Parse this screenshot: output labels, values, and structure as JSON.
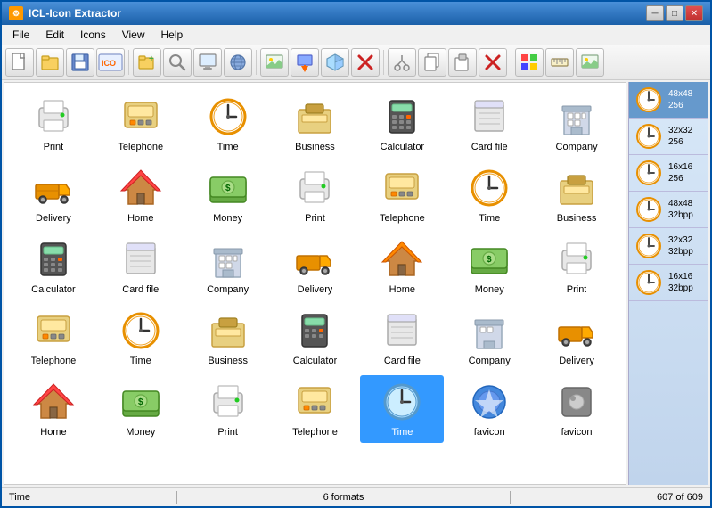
{
  "window": {
    "title": "ICL-Icon Extractor",
    "title_icon": "📦"
  },
  "title_controls": {
    "minimize": "─",
    "maximize": "□",
    "close": "✕"
  },
  "menu": {
    "items": [
      "File",
      "Edit",
      "Icons",
      "View",
      "Help"
    ]
  },
  "toolbar": {
    "buttons": [
      {
        "name": "new",
        "icon": "📄"
      },
      {
        "name": "open",
        "icon": "📂"
      },
      {
        "name": "save",
        "icon": "💾"
      },
      {
        "name": "ico",
        "icon": "🏷"
      },
      {
        "name": "add-folder",
        "icon": "📁"
      },
      {
        "name": "search",
        "icon": "🔍"
      },
      {
        "name": "monitor",
        "icon": "🖥"
      },
      {
        "name": "globe",
        "icon": "🌐"
      },
      {
        "name": "image",
        "icon": "🖼"
      },
      {
        "name": "download",
        "icon": "⬇"
      },
      {
        "name": "cube",
        "icon": "📦"
      },
      {
        "name": "delete-red",
        "icon": "✖"
      },
      {
        "name": "cut",
        "icon": "✂"
      },
      {
        "name": "copy",
        "icon": "📋"
      },
      {
        "name": "paste",
        "icon": "📋"
      },
      {
        "name": "delete",
        "icon": "🗑"
      },
      {
        "name": "windows",
        "icon": "🪟"
      },
      {
        "name": "ruler",
        "icon": "📏"
      },
      {
        "name": "image2",
        "icon": "🖼"
      }
    ]
  },
  "icons": [
    {
      "label": "Print",
      "emoji": "🖨",
      "type": "printer"
    },
    {
      "label": "Telephone",
      "emoji": "☎",
      "type": "telephone"
    },
    {
      "label": "Time",
      "emoji": "🕐",
      "type": "clock"
    },
    {
      "label": "Business",
      "emoji": "💼",
      "type": "business"
    },
    {
      "label": "Calculator",
      "emoji": "🧮",
      "type": "calculator"
    },
    {
      "label": "Card file",
      "emoji": "🗃",
      "type": "cardfile"
    },
    {
      "label": "Company",
      "emoji": "🏢",
      "type": "building"
    },
    {
      "label": "Delivery",
      "emoji": "🚚",
      "type": "truck"
    },
    {
      "label": "Home",
      "emoji": "🏠",
      "type": "house"
    },
    {
      "label": "Money",
      "emoji": "💵",
      "type": "money"
    },
    {
      "label": "Print",
      "emoji": "🖨",
      "type": "printer"
    },
    {
      "label": "Telephone",
      "emoji": "☎",
      "type": "telephone"
    },
    {
      "label": "Time",
      "emoji": "🕐",
      "type": "clock"
    },
    {
      "label": "Business",
      "emoji": "💼",
      "type": "business"
    },
    {
      "label": "Calculator",
      "emoji": "🧮",
      "type": "calculator"
    },
    {
      "label": "Card file",
      "emoji": "🗃",
      "type": "cardfile"
    },
    {
      "label": "Company",
      "emoji": "🏢",
      "type": "building"
    },
    {
      "label": "Delivery",
      "emoji": "🚚",
      "type": "truck"
    },
    {
      "label": "Home",
      "emoji": "🏠",
      "type": "house"
    },
    {
      "label": "Money",
      "emoji": "💵",
      "type": "money"
    },
    {
      "label": "Print",
      "emoji": "🖨",
      "type": "printer"
    },
    {
      "label": "Telephone",
      "emoji": "☎",
      "type": "telephone"
    },
    {
      "label": "Time",
      "emoji": "🕐",
      "type": "clock"
    },
    {
      "label": "Business",
      "emoji": "💼",
      "type": "business"
    },
    {
      "label": "Calculator",
      "emoji": "🧮",
      "type": "calculator"
    },
    {
      "label": "Card file",
      "emoji": "🗃",
      "type": "cardfile"
    },
    {
      "label": "Company",
      "emoji": "🏢",
      "type": "building"
    },
    {
      "label": "Delivery",
      "emoji": "🚚",
      "type": "truck"
    },
    {
      "label": "Home",
      "emoji": "🏠",
      "type": "house"
    },
    {
      "label": "Money",
      "emoji": "💵",
      "type": "money"
    },
    {
      "label": "Print",
      "emoji": "🖨",
      "type": "printer"
    },
    {
      "label": "Telephone",
      "emoji": "☎",
      "type": "telephone"
    },
    {
      "label": "Time",
      "emoji": "🕐",
      "type": "clock",
      "selected": true
    },
    {
      "label": "favicon",
      "emoji": "🌐",
      "type": "favicon"
    },
    {
      "label": "favicon",
      "emoji": "⚙",
      "type": "favicon2"
    }
  ],
  "side_panel": {
    "items": [
      {
        "size": "48x48",
        "bits": "256",
        "selected": true
      },
      {
        "size": "32x32",
        "bits": "256"
      },
      {
        "size": "16x16",
        "bits": "256"
      },
      {
        "size": "48x48",
        "bits": "32bpp"
      },
      {
        "size": "32x32",
        "bits": "32bpp"
      },
      {
        "size": "16x16",
        "bits": "32bpp"
      }
    ]
  },
  "status_bar": {
    "left": "Time",
    "center": "6 formats",
    "right": "607 of 609"
  }
}
